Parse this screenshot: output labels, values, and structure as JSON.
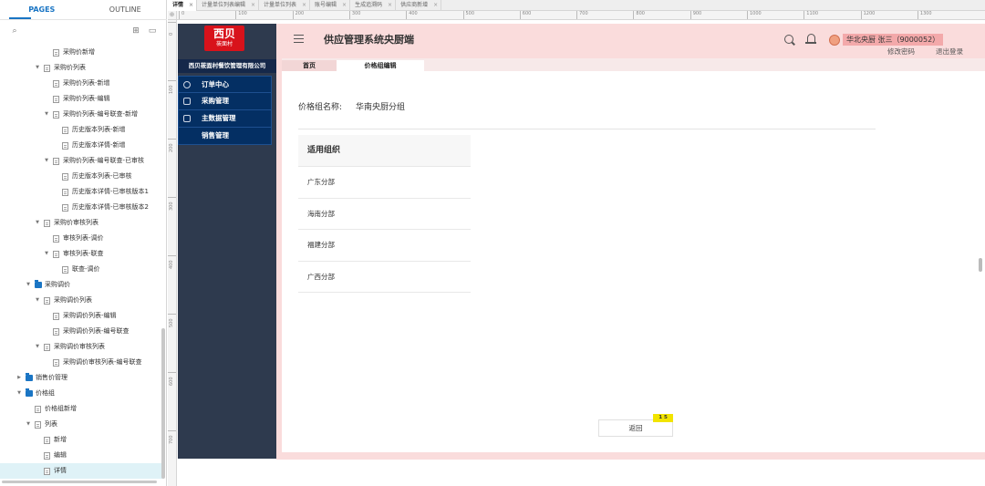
{
  "left_panel": {
    "tabs": [
      "PAGES",
      "OUTLINE"
    ],
    "tree": [
      {
        "label": "采购价新增",
        "depth": 3,
        "kind": "page",
        "arrow": ""
      },
      {
        "label": "采购价列表",
        "depth": 2,
        "kind": "page",
        "arrow": "▼"
      },
      {
        "label": "采购价列表-新增",
        "depth": 3,
        "kind": "page",
        "arrow": ""
      },
      {
        "label": "采购价列表-编辑",
        "depth": 3,
        "kind": "page",
        "arrow": ""
      },
      {
        "label": "采购价列表-编号联查-新增",
        "depth": 3,
        "kind": "page",
        "arrow": "▼"
      },
      {
        "label": "历史版本列表-新增",
        "depth": 4,
        "kind": "page",
        "arrow": ""
      },
      {
        "label": "历史版本详情-新增",
        "depth": 4,
        "kind": "page",
        "arrow": ""
      },
      {
        "label": "采购价列表-编号联查-已审核",
        "depth": 3,
        "kind": "page",
        "arrow": "▼"
      },
      {
        "label": "历史版本列表-已审核",
        "depth": 4,
        "kind": "page",
        "arrow": ""
      },
      {
        "label": "历史版本详情-已审核版本1",
        "depth": 4,
        "kind": "page",
        "arrow": ""
      },
      {
        "label": "历史版本详情-已审核版本2",
        "depth": 4,
        "kind": "page",
        "arrow": ""
      },
      {
        "label": "采购价审核列表",
        "depth": 2,
        "kind": "page",
        "arrow": "▼"
      },
      {
        "label": "审核列表-调价",
        "depth": 3,
        "kind": "page",
        "arrow": ""
      },
      {
        "label": "审核列表-联查",
        "depth": 3,
        "kind": "page",
        "arrow": "▼"
      },
      {
        "label": "联查-调价",
        "depth": 4,
        "kind": "page",
        "arrow": ""
      },
      {
        "label": "采购调价",
        "depth": 1,
        "kind": "folder",
        "arrow": "▼"
      },
      {
        "label": "采购调价列表",
        "depth": 2,
        "kind": "page",
        "arrow": "▼"
      },
      {
        "label": "采购调价列表-编辑",
        "depth": 3,
        "kind": "page",
        "arrow": ""
      },
      {
        "label": "采购调价列表-编号联查",
        "depth": 3,
        "kind": "page",
        "arrow": ""
      },
      {
        "label": "采购调价审核列表",
        "depth": 2,
        "kind": "page",
        "arrow": "▼"
      },
      {
        "label": "采购调价审核列表-编号联查",
        "depth": 3,
        "kind": "page",
        "arrow": ""
      },
      {
        "label": "销售价管理",
        "depth": 0,
        "kind": "folder",
        "arrow": "▶"
      },
      {
        "label": "价格组",
        "depth": 0,
        "kind": "folder",
        "arrow": "▼"
      },
      {
        "label": "价格组新增",
        "depth": 1,
        "kind": "page",
        "arrow": ""
      },
      {
        "label": "列表",
        "depth": 1,
        "kind": "page",
        "arrow": "▼"
      },
      {
        "label": "新增",
        "depth": 2,
        "kind": "page",
        "arrow": ""
      },
      {
        "label": "编辑",
        "depth": 2,
        "kind": "page",
        "arrow": ""
      },
      {
        "label": "详情",
        "depth": 2,
        "kind": "page",
        "arrow": "",
        "selected": true
      }
    ]
  },
  "file_tabs": [
    "详情",
    "计量单位列表编辑",
    "计量单位列表",
    "账号编辑",
    "生成追溯码",
    "供应商新增"
  ],
  "ruler": {
    "h_marks": [
      "0",
      "100",
      "200",
      "300",
      "400",
      "500",
      "600",
      "700",
      "800",
      "900",
      "1000",
      "1100",
      "1200",
      "1300"
    ],
    "v_marks": [
      "0",
      "100",
      "200",
      "300",
      "400",
      "500",
      "600",
      "700"
    ]
  },
  "app": {
    "logo_big": "西贝",
    "logo_small": "莜面村",
    "company": "西贝莜面村餐饮管理有限公司",
    "menu": [
      {
        "label": "订单中心",
        "icon": "dashboard-icon"
      },
      {
        "label": "采购管理",
        "icon": "edit-icon"
      },
      {
        "label": "主数据管理",
        "icon": "list-icon"
      },
      {
        "label": "销售管理",
        "icon": ""
      }
    ],
    "title": "供应管理系统央厨端",
    "user": "华北央厨 张三（9000052）",
    "change_password": "修改密码",
    "logout": "退出登录",
    "tabs": [
      "首页",
      "价格组编辑"
    ],
    "price_group_label": "价格组名称:",
    "price_group_value": "华南央厨分组",
    "org_header": "适用组织",
    "orgs": [
      "广东分部",
      "海南分部",
      "福建分部",
      "广西分部"
    ],
    "return_button": "返回",
    "note_badge": "1 5"
  }
}
